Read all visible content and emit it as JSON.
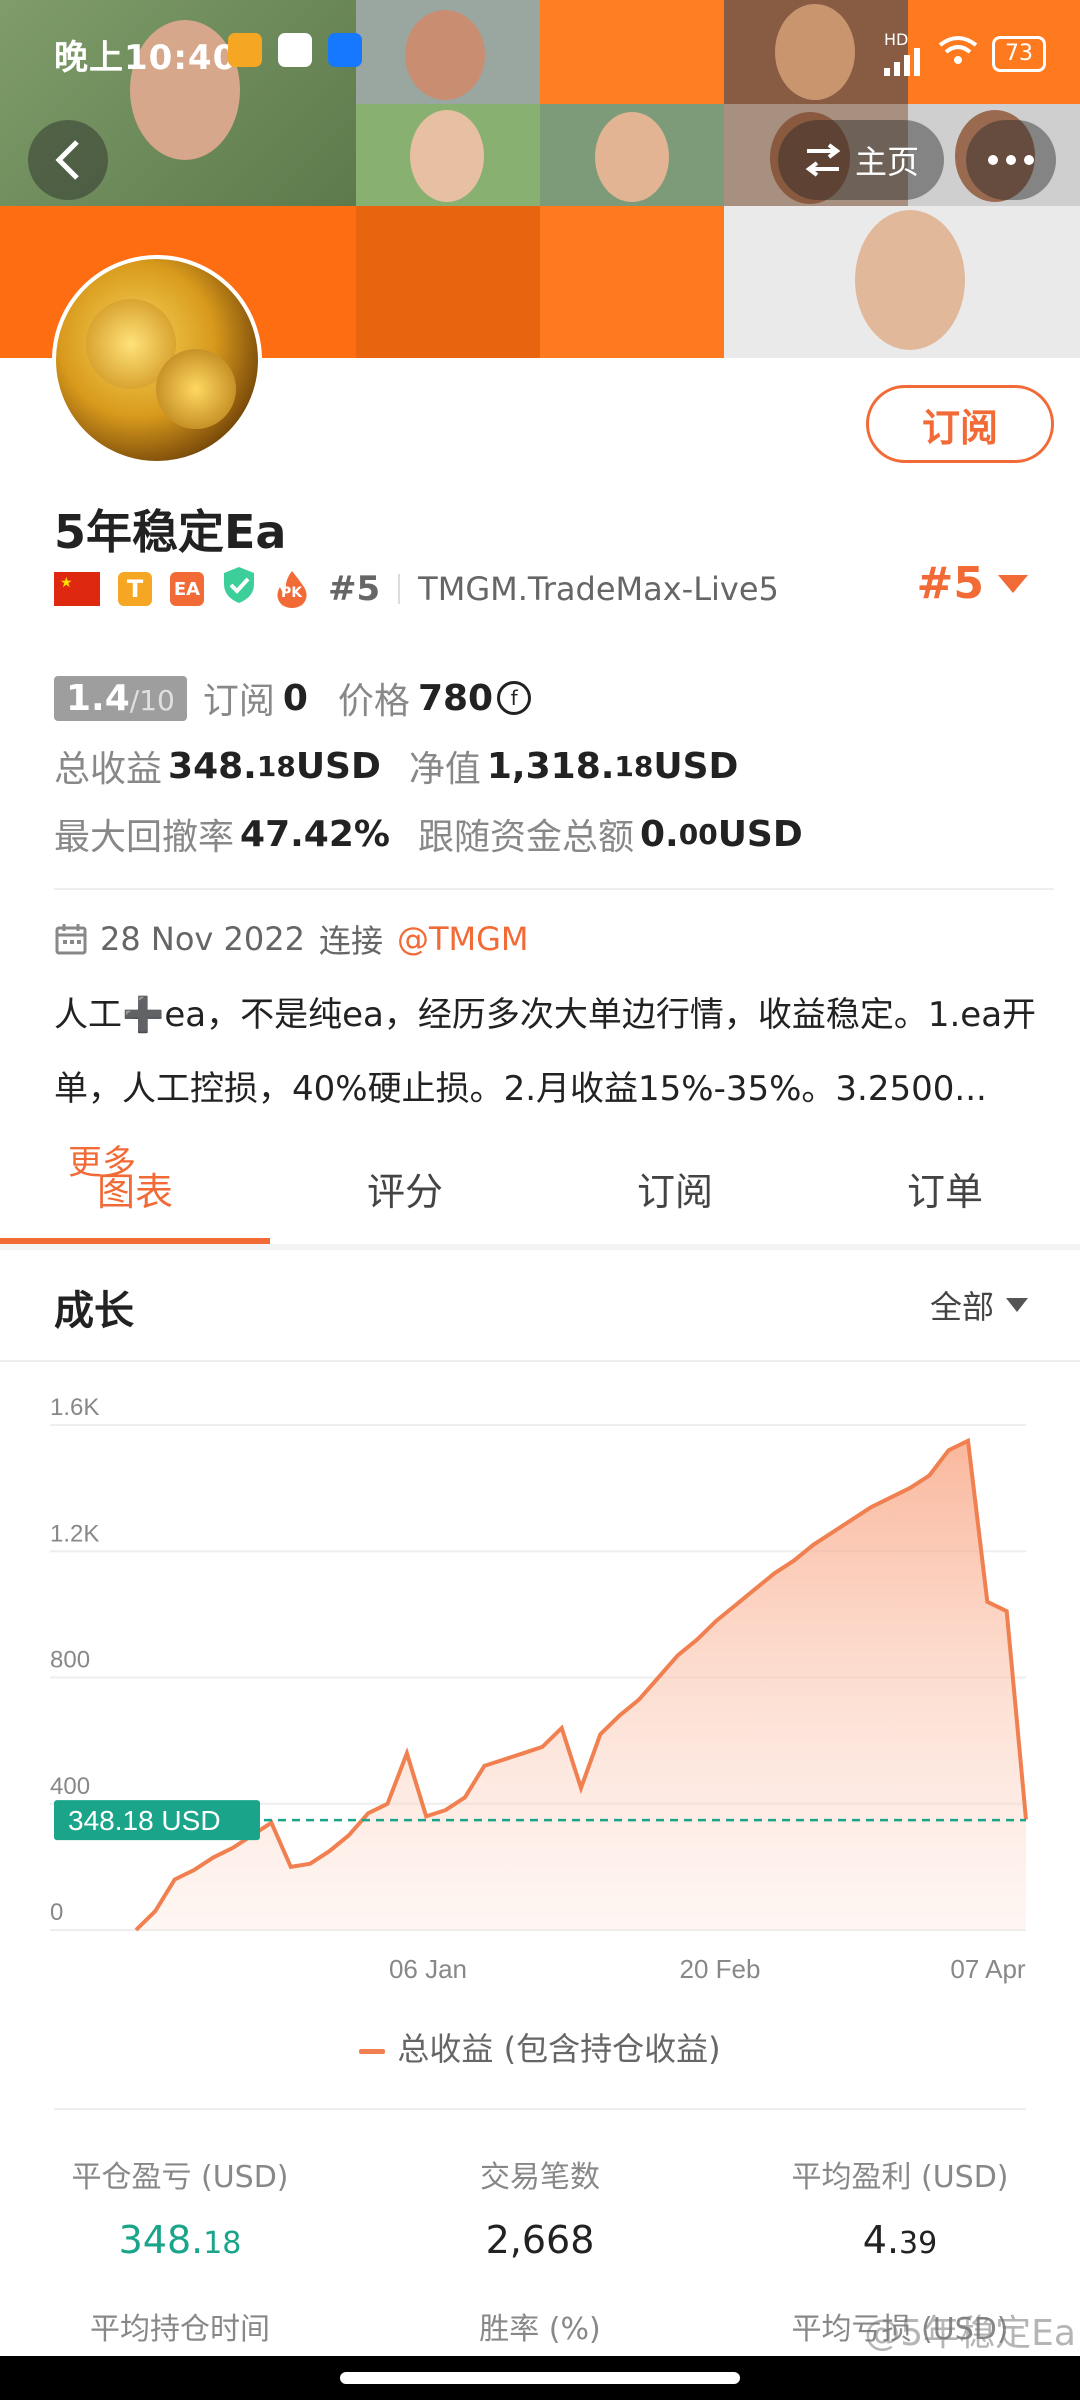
{
  "status_bar": {
    "time": "晚上10:40",
    "battery": "73",
    "network": "HD"
  },
  "header": {
    "home_label": "主页"
  },
  "profile": {
    "subscribe_label": "订阅",
    "name": "5年稳定Ea",
    "badge_t": "T",
    "badge_ea": "EA",
    "pk_label": "PK",
    "rank": "#5",
    "account": "TMGM.TradeMax-Live5",
    "rank_big": "#5"
  },
  "stats": {
    "rating_int": "1.4",
    "rating_den": "/10",
    "subscribe_label": "订阅",
    "subscribe_value": "0",
    "price_label": "价格",
    "price_value": "780",
    "total_profit_label": "总收益",
    "total_profit_main": "348.",
    "total_profit_dec": "18",
    "total_profit_unit": " USD",
    "equity_label": "净值",
    "equity_main": "1,318.",
    "equity_dec": "18",
    "equity_unit": " USD",
    "drawdown_label": "最大回撤率",
    "drawdown_value": "47.42%",
    "follow_label": "跟随资金总额",
    "follow_main": "0.",
    "follow_dec": "00",
    "follow_unit": " USD"
  },
  "connection": {
    "date": "28 Nov 2022",
    "connect_word": "连接",
    "broker": "@TMGM"
  },
  "description": {
    "line1": "人工➕ea，不是纯ea，经历多次大单边行情，收益稳定。1.ea开",
    "line2": "单，人工控损，40%硬止损。2.月收益15%-35%。3.2500...",
    "more": "更多"
  },
  "tabs": [
    "图表",
    "评分",
    "订阅",
    "订单"
  ],
  "chart_section": {
    "title": "成长",
    "filter": "全部"
  },
  "chart_data": {
    "type": "area",
    "x_ticks": [
      "06 Jan",
      "20 Feb",
      "07 Apr"
    ],
    "y_ticks": [
      "0",
      "400",
      "800",
      "1.2K",
      "1.6K"
    ],
    "ylim": [
      0,
      1600
    ],
    "current_label": "348.18 USD",
    "current_value": 348.18,
    "legend": "总收益 (包含持仓收益)",
    "series": [
      {
        "name": "总收益 (包含持仓收益)",
        "values": [
          0,
          60,
          160,
          190,
          230,
          260,
          300,
          340,
          200,
          210,
          250,
          300,
          370,
          400,
          560,
          360,
          380,
          420,
          520,
          540,
          560,
          580,
          640,
          450,
          620,
          680,
          730,
          800,
          870,
          920,
          980,
          1030,
          1080,
          1130,
          1170,
          1220,
          1260,
          1300,
          1340,
          1370,
          1400,
          1440,
          1520,
          1550,
          1040,
          1010,
          350
        ]
      }
    ]
  },
  "bottom_stats": {
    "row1": [
      {
        "label": "平仓盈亏 (USD)",
        "main": "348.",
        "dec": "18"
      },
      {
        "label": "交易笔数",
        "main": "2,668",
        "dec": ""
      },
      {
        "label": "平均盈利 (USD)",
        "main": "4.",
        "dec": "39"
      }
    ],
    "row2": [
      "平均持仓时间",
      "胜率 (%)",
      "平均亏损 (USD)"
    ],
    "watermark": "@5年稳定Ea"
  }
}
